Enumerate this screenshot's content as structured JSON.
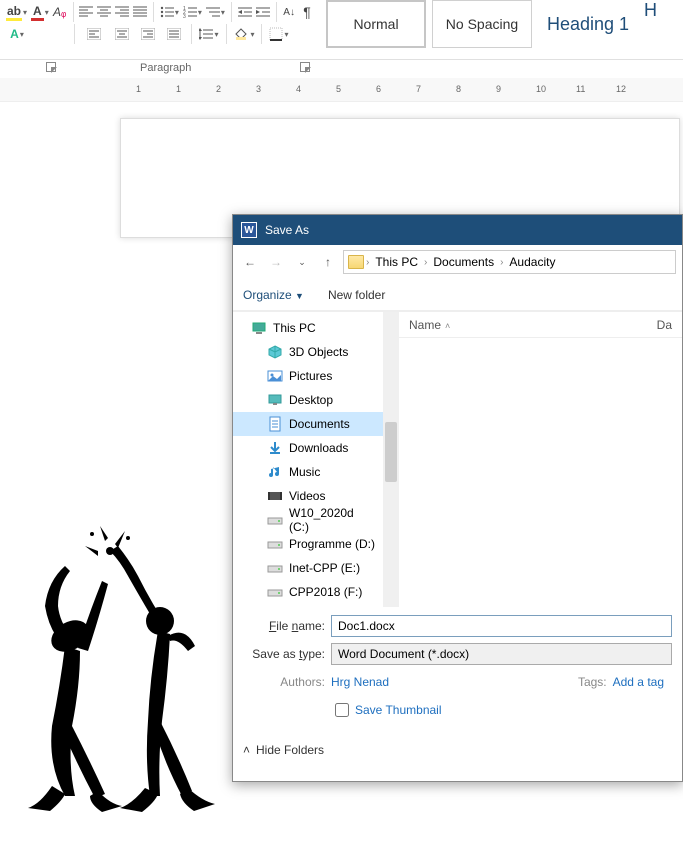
{
  "ribbon": {
    "group_paragraph": "Paragraph",
    "styles": {
      "normal": "Normal",
      "nospacing": "No Spacing",
      "heading1": "Heading 1",
      "heading2_partial": "H"
    }
  },
  "ruler": {
    "marks": [
      "1",
      "",
      "1",
      "",
      "2",
      "",
      "3",
      "",
      "4",
      "",
      "5",
      "",
      "6",
      "",
      "7",
      "",
      "8",
      "",
      "9",
      "",
      "10",
      "",
      "11",
      "",
      "12"
    ]
  },
  "dialog": {
    "title": "Save As",
    "breadcrumb": [
      "This PC",
      "Documents",
      "Audacity"
    ],
    "toolbar": {
      "organize": "Organize",
      "newfolder": "New folder"
    },
    "tree": [
      {
        "label": "This PC",
        "icon": "pc",
        "sub": false,
        "selected": false
      },
      {
        "label": "3D Objects",
        "icon": "cube",
        "sub": true,
        "selected": false
      },
      {
        "label": "Pictures",
        "icon": "pic",
        "sub": true,
        "selected": false
      },
      {
        "label": "Desktop",
        "icon": "desk",
        "sub": true,
        "selected": false
      },
      {
        "label": "Documents",
        "icon": "doc",
        "sub": true,
        "selected": true
      },
      {
        "label": "Downloads",
        "icon": "down",
        "sub": true,
        "selected": false
      },
      {
        "label": "Music",
        "icon": "music",
        "sub": true,
        "selected": false
      },
      {
        "label": "Videos",
        "icon": "vid",
        "sub": true,
        "selected": false
      },
      {
        "label": "W10_2020d (C:)",
        "icon": "drive",
        "sub": true,
        "selected": false
      },
      {
        "label": "Programme (D:)",
        "icon": "drive",
        "sub": true,
        "selected": false
      },
      {
        "label": "Inet-CPP (E:)",
        "icon": "drive",
        "sub": true,
        "selected": false
      },
      {
        "label": "CPP2018 (F:)",
        "icon": "drive",
        "sub": true,
        "selected": false
      }
    ],
    "columns": {
      "name": "Name",
      "date": "Da"
    },
    "filename_label": "File name:",
    "filename": "Doc1.docx",
    "saveastype_label": "Save as type:",
    "saveastype": "Word Document (*.docx)",
    "authors_label": "Authors:",
    "authors": "Hrg Nenad",
    "tags_label": "Tags:",
    "tags_value": "Add a tag",
    "save_thumbnail": "Save Thumbnail",
    "hide_folders": "Hide Folders"
  }
}
